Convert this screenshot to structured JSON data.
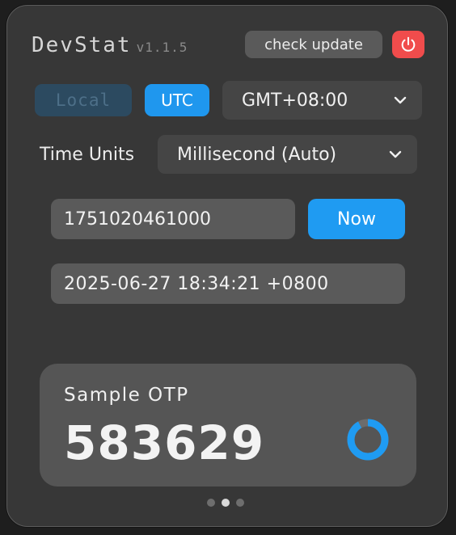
{
  "header": {
    "title": "DevStat",
    "version": "v1.1.5",
    "update_label": "check update",
    "power_icon": "power-icon",
    "power_color": "#f04c4c"
  },
  "timezone": {
    "local_label": "Local",
    "utc_label": "UTC",
    "selected": "GMT+08:00",
    "active_mode": "UTC",
    "accent": "#1f97ee"
  },
  "units": {
    "label": "Time Units",
    "selected": "Millisecond (Auto)"
  },
  "timestamp": {
    "value": "1751020461000",
    "now_label": "Now"
  },
  "datetime": {
    "value": "2025-06-27 18:34:21 +0800"
  },
  "otp": {
    "label": "Sample OTP",
    "code": "583629",
    "remaining_fraction": 0.92,
    "timer_color": "#1f9bf2"
  },
  "pager": {
    "count": 3,
    "active_index": 1
  }
}
